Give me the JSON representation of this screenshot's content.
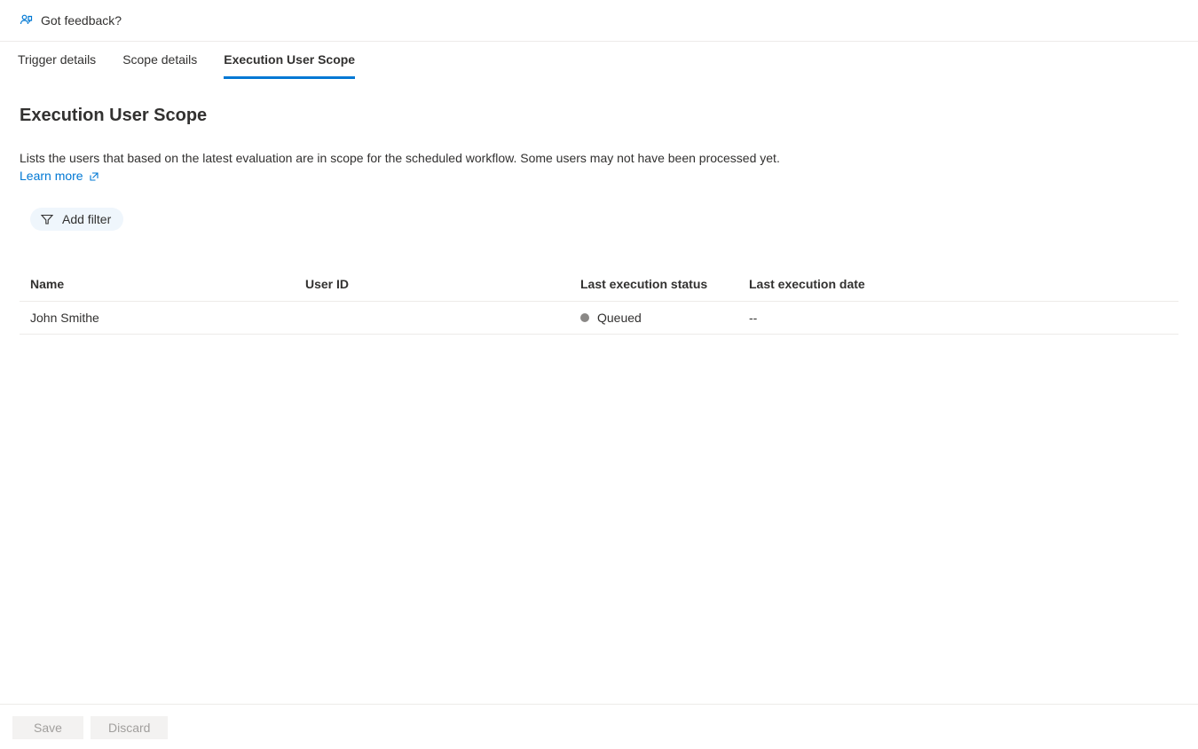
{
  "feedback": {
    "label": "Got feedback?"
  },
  "tabs": [
    {
      "label": "Trigger details",
      "active": false
    },
    {
      "label": "Scope details",
      "active": false
    },
    {
      "label": "Execution User Scope",
      "active": true
    }
  ],
  "page": {
    "title": "Execution User Scope",
    "description": "Lists the users that based on the latest evaluation are in scope for the scheduled workflow. Some users may not have been processed yet.",
    "learnMore": "Learn more"
  },
  "filter": {
    "addFilterLabel": "Add filter"
  },
  "table": {
    "columns": {
      "name": "Name",
      "userId": "User ID",
      "status": "Last execution status",
      "date": "Last execution date"
    },
    "rows": [
      {
        "name": "John Smithe",
        "userId": "",
        "status": "Queued",
        "statusColor": "#8a8886",
        "date": "--"
      }
    ]
  },
  "footer": {
    "save": "Save",
    "discard": "Discard"
  }
}
